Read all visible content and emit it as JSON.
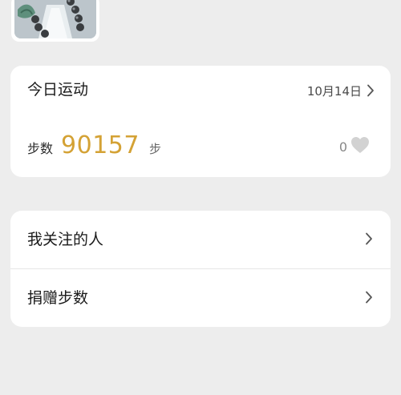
{
  "sport": {
    "title": "今日运动",
    "date": "10月14日",
    "steps_label": "步数",
    "steps_value": "90157",
    "steps_unit": "步",
    "likes": "0"
  },
  "menu": {
    "items": [
      {
        "label": "我关注的人"
      },
      {
        "label": "捐赠步数"
      }
    ]
  },
  "colors": {
    "background": "#ededed",
    "card": "#ffffff",
    "steps_accent": "#d4a235",
    "heart": "#d2d2d2"
  },
  "icons": [
    "avatar-image",
    "chevron-right-icon",
    "heart-icon"
  ]
}
